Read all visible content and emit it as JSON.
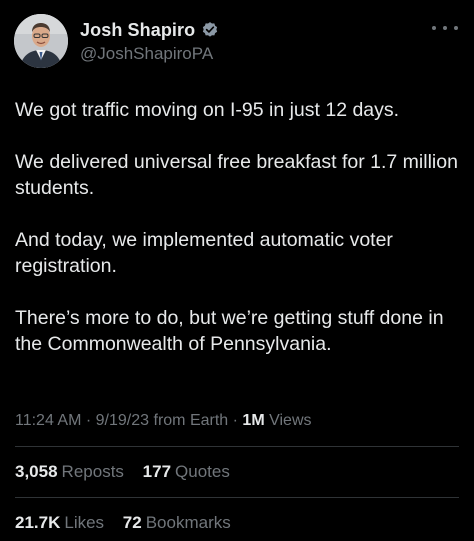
{
  "author": {
    "display_name": "Josh Shapiro",
    "handle": "@JoshShapiroPA",
    "verified": true,
    "verified_color": "#8b98a5"
  },
  "tweet": {
    "paragraphs": [
      "We got traffic moving on I-95 in just 12 days.",
      "We delivered universal free breakfast for 1.7 million students.",
      "And today, we implemented automatic voter registration.",
      "There’s more to do, but we’re getting stuff done in the Commonwealth of Pennsylvania."
    ]
  },
  "meta": {
    "time": "11:24 AM",
    "date": "9/19/23",
    "source": "from Earth",
    "views_count": "1M",
    "views_label": "Views"
  },
  "stats": {
    "reposts_count": "3,058",
    "reposts_label": "Reposts",
    "quotes_count": "177",
    "quotes_label": "Quotes",
    "likes_count": "21.7K",
    "likes_label": "Likes",
    "bookmarks_count": "72",
    "bookmarks_label": "Bookmarks"
  },
  "colors": {
    "background": "#000000",
    "text_primary": "#e7e9ea",
    "text_secondary": "#71767b",
    "divider": "#2f3336"
  },
  "icons": {
    "verified": "verified-badge-icon",
    "more": "more-options-icon"
  }
}
